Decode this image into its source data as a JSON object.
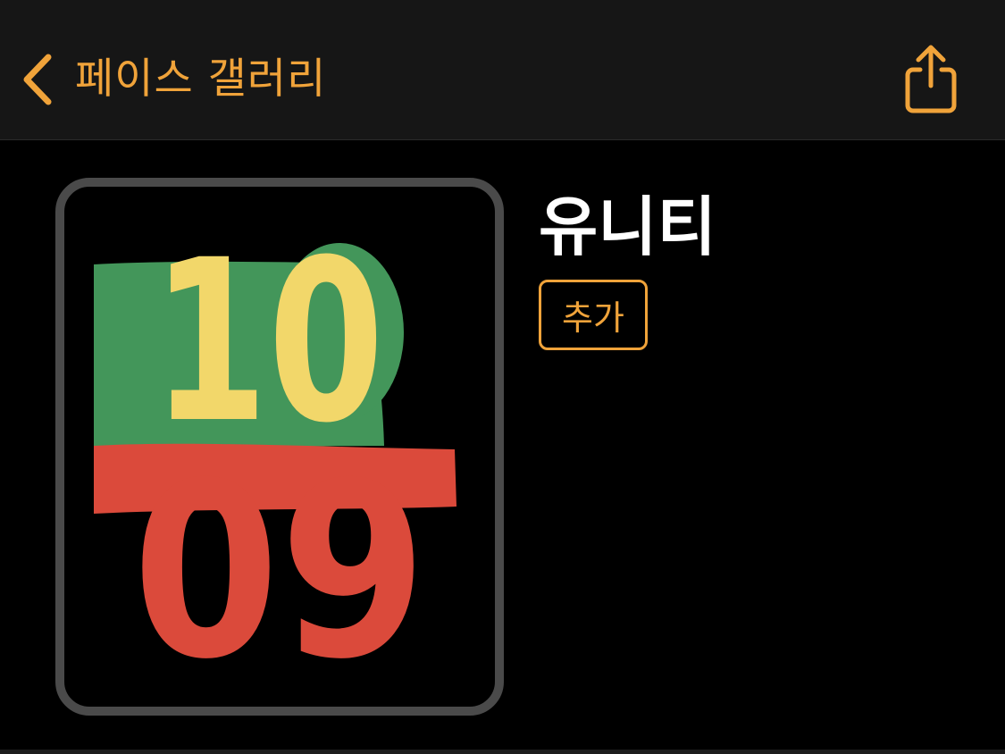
{
  "navbar": {
    "back_label": "페이스 갤러리",
    "back_icon": "chevron-left-icon",
    "share_icon": "share-icon"
  },
  "face": {
    "title": "유니티",
    "add_label": "추가",
    "hour": "10",
    "minute": "09"
  },
  "colors": {
    "accent": "#F0A33A",
    "green": "#43965A",
    "yellow": "#F2D76A",
    "red": "#DB4A3B",
    "frame": "#4A4A4A",
    "navbar_bg": "#161616"
  }
}
